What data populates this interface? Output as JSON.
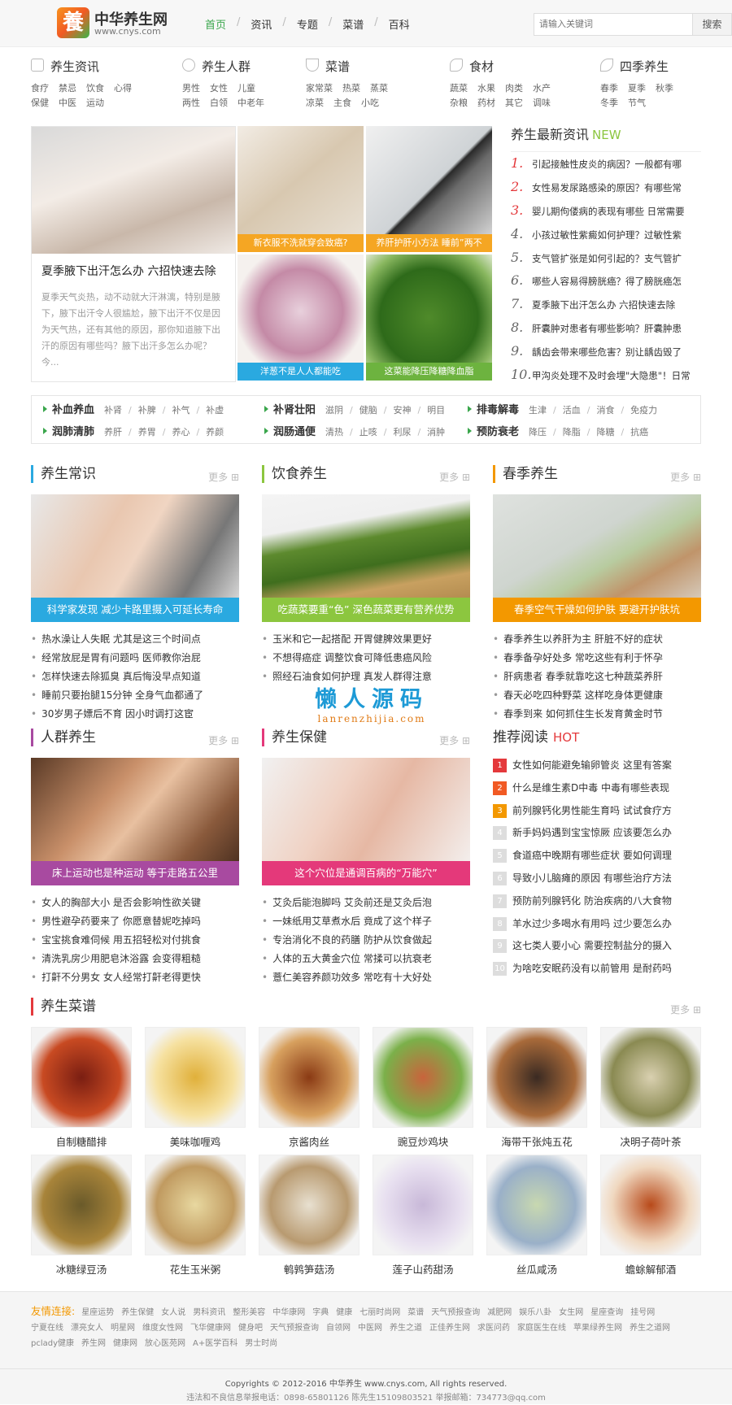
{
  "header": {
    "logo_char": "養",
    "brand": "中华养生网",
    "domain": "www.cnys.com",
    "nav": [
      "首页",
      "资讯",
      "专题",
      "菜谱",
      "百科"
    ],
    "search_placeholder": "请输入关键词",
    "search_button": "搜索",
    "accent": "#3aa64c"
  },
  "categories": [
    {
      "title": "养生资讯",
      "icon": "document-icon",
      "links": [
        "食疗",
        "禁忌",
        "饮食",
        "心得",
        "保健",
        "中医",
        "运动"
      ]
    },
    {
      "title": "养生人群",
      "icon": "user-icon",
      "links": [
        "男性",
        "女性",
        "儿童",
        "两性",
        "白领",
        "中老年"
      ]
    },
    {
      "title": "菜谱",
      "icon": "bowl-icon",
      "links": [
        "家常菜",
        "热菜",
        "蒸菜",
        "凉菜",
        "主食",
        "小吃"
      ]
    },
    {
      "title": "食材",
      "icon": "food-icon",
      "links": [
        "蔬菜",
        "水果",
        "肉类",
        "水产",
        "杂粮",
        "药材",
        "其它",
        "调味"
      ]
    },
    {
      "title": "四季养生",
      "icon": "leaf-icon",
      "links": [
        "春季",
        "夏季",
        "秋季",
        "冬季",
        "节气"
      ]
    }
  ],
  "hero": {
    "big_title": "夏季腋下出汗怎么办 六招快速去除",
    "big_desc": "夏季天气炎热，动不动就大汗淋漓，特别是腋下，腋下出汗令人很尴尬，腋下出汗不仅是因为天气热，还有其他的原因，那你知道腋下出汗的原因有哪些吗？腋下出汗多怎么办呢？今...",
    "tiles": [
      {
        "caption": "新衣服不洗就穿会致癌?",
        "color": "#f5a623"
      },
      {
        "caption": "养肝护肝小方法 睡前”两不",
        "color": "#f5a623"
      },
      {
        "caption": "洋葱不是人人都能吃",
        "color": "#2aa9e0"
      },
      {
        "caption": "这菜能降压降糖降血脂",
        "color": "#6db33f"
      }
    ]
  },
  "latest": {
    "title": "养生最新资讯",
    "badge": "NEW",
    "items": [
      "引起接触性皮炎的病因？一般都有哪",
      "女性易发尿路感染的原因？有哪些常",
      "婴儿期佝偻病的表现有哪些 日常需要",
      "小孩过敏性紫癜如何护理？过敏性紫",
      "支气管扩张是如何引起的？支气管扩",
      "哪些人容易得膀胱癌？得了膀胱癌怎",
      "夏季腋下出汗怎么办 六招快速去除",
      "肝囊肿对患者有哪些影响？肝囊肿患",
      "龋齿会带来哪些危害？别让龋齿毁了",
      "甲沟炎处理不及时会埋\"大隐患\"！日常"
    ]
  },
  "tags": [
    {
      "name": "补血养血",
      "items": [
        "补肾",
        "补脾",
        "补气",
        "补虚"
      ]
    },
    {
      "name": "补肾壮阳",
      "items": [
        "滋阴",
        "健脑",
        "安神",
        "明目"
      ]
    },
    {
      "name": "排毒解毒",
      "items": [
        "生津",
        "活血",
        "消食",
        "免疫力"
      ]
    },
    {
      "name": "润肺清肺",
      "items": [
        "养肝",
        "养胃",
        "养心",
        "养颜"
      ]
    },
    {
      "name": "润肠通便",
      "items": [
        "清热",
        "止咳",
        "利尿",
        "消肿"
      ]
    },
    {
      "name": "预防衰老",
      "items": [
        "降压",
        "降脂",
        "降糖",
        "抗癌"
      ]
    }
  ],
  "more_label": "更多",
  "columns": [
    {
      "title": "养生常识",
      "border": "#2aa9e0",
      "caption": "科学家发现 减少卡路里摄入可延长寿命",
      "cap_color": "#2aa9e0",
      "items": [
        "热水澡让人失眠 尤其是这三个时间点",
        "经常放屁是胃有问题吗 医师教你治屁",
        "怎样快速去除狐臭 真后悔没早点知道",
        "睡前只要抬腿15分钟 全身气血都通了",
        "30岁男子嫖后不育 因小时调打这宦"
      ]
    },
    {
      "title": "饮食养生",
      "border": "#8cc63f",
      "caption": "吃蔬菜要重“色” 深色蔬菜更有营养优势",
      "cap_color": "#8cc63f",
      "items": [
        "玉米和它一起搭配 开胃健脾效果更好",
        "不想得癌症 调整饮食可降低患癌风险",
        "照经石油食如何护理 真发人群得注意"
      ]
    },
    {
      "title": "春季养生",
      "border": "#f39800",
      "caption": "春季空气干燥如何护肤 要避开护肤坑",
      "cap_color": "#f39800",
      "items": [
        "春季养生以养肝为主 肝脏不好的症状",
        "春季备孕好处多 常吃这些有利于怀孕",
        "肝病患者 春季就靠吃这七种蔬菜养肝",
        "春天必吃四种野菜 这样吃身体更健康",
        "春季到来 如何抓住生长发育黄金时节"
      ]
    },
    {
      "title": "人群养生",
      "border": "#a84aa0",
      "caption": "床上运动也是种运动 等于走路五公里",
      "cap_color": "#a84aa0",
      "items": [
        "女人的胸部大小 是否会影响性欲关键",
        "男性避孕药要来了 你愿意替妮吃掉吗",
        "宝宝挑食难伺候 用五招轻松对付挑食",
        "清洗乳房少用肥皂沐浴露 会变得粗糙",
        "打鼾不分男女 女人经常打鼾老得更快"
      ]
    },
    {
      "title": "养生保健",
      "border": "#e4397a",
      "caption": "这个穴位是通调百病的“万能穴”",
      "cap_color": "#e4397a",
      "items": [
        "艾灸后能泡脚吗 艾灸前还是艾灸后泡",
        "一妹纸用艾草煮水后 竟成了这个样子",
        "专治消化不良的药膳 防护从饮食做起",
        "人体的五大黄金穴位 常揉可以抗衰老",
        "薏仁美容养颜功效多 常吃有十大好处"
      ]
    }
  ],
  "watermark": {
    "cn": "懒人源码",
    "en": "lanrenzhijia.com"
  },
  "recommend": {
    "title": "推荐阅读",
    "badge": "HOT",
    "items": [
      "女性如何能避免输卵管炎 这里有答案",
      "什么是维生素D中毒 中毒有哪些表现",
      "前列腺钙化男性能生育吗 试试食疗方",
      "新手妈妈遇到宝宝惊厥 应该要怎么办",
      "食道癌中晚期有哪些症状 要如何调理",
      "导致小儿脑瘫的原因 有哪些治疗方法",
      "预防前列腺钙化 防治疾病的八大食物",
      "羊水过少多喝水有用吗 过少要怎么办",
      "这七类人要小心 需要控制盐分的摄入",
      "为啥吃安眠药没有以前管用 是耐药吗"
    ],
    "top_colors": [
      "#e4393c",
      "#f15a24",
      "#f39800"
    ]
  },
  "recipes": {
    "title": "养生菜谱",
    "items": [
      {
        "name": "自制糖醋排",
        "c1": "#7a1e12",
        "c2": "#c84a22"
      },
      {
        "name": "美味咖喱鸡",
        "c1": "#e0b03a",
        "c2": "#f6e1a0"
      },
      {
        "name": "京酱肉丝",
        "c1": "#8a3a14",
        "c2": "#d7a05e"
      },
      {
        "name": "豌豆炒鸡块",
        "c1": "#c8643c",
        "c2": "#7bb04a"
      },
      {
        "name": "海带干张炖五花",
        "c1": "#3a2a22",
        "c2": "#a86a3a"
      },
      {
        "name": "决明子荷叶茶",
        "c1": "#d9d0b0",
        "c2": "#8a8a52"
      },
      {
        "name": "冰糖绿豆汤",
        "c1": "#6a5a2a",
        "c2": "#a8843a"
      },
      {
        "name": "花生玉米粥",
        "c1": "#e8d8a0",
        "c2": "#c09a60"
      },
      {
        "name": "鹌鹑笋菇汤",
        "c1": "#e8e0d0",
        "c2": "#b89a70"
      },
      {
        "name": "莲子山药甜汤",
        "c1": "#c8b8d8",
        "c2": "#e8e0f0"
      },
      {
        "name": "丝瓜咸汤",
        "c1": "#c8d8b0",
        "c2": "#9ab0c8"
      },
      {
        "name": "蟾蜍解郁酒",
        "c1": "#b84a1a",
        "c2": "#f0d8c0"
      }
    ]
  },
  "friend_links": {
    "label": "友情连接:",
    "items": [
      "星座运势",
      "养生保健",
      "女人说",
      "男科资讯",
      "整形美容",
      "中华康网",
      "字典",
      "健康",
      "七丽时尚网",
      "菜谱",
      "天气预报查询",
      "减肥网",
      "娱乐八卦",
      "女生网",
      "星座查询",
      "挂号网",
      "宁夏在线",
      "漂亮女人",
      "明星网",
      "维度女性网",
      "飞华健康网",
      "健身吧",
      "天气预报查询",
      "自领网",
      "中医网",
      "养生之道",
      "正佳养生网",
      "求医问药",
      "家庭医生在线",
      "苹果绿养生网",
      "养生之道网",
      "pclady健康",
      "养生网",
      "健康网",
      "放心医苑网",
      "A+医学百科",
      "男士时尚"
    ]
  },
  "footer": {
    "copyright": "Copyrights © 2012-2016 中华养生 www.cnys.com, All rights reserved.",
    "line2": "违法和不良信息举报电话：0898-65801126     陈先生15109803521     举报邮箱：734773@qq.com"
  }
}
